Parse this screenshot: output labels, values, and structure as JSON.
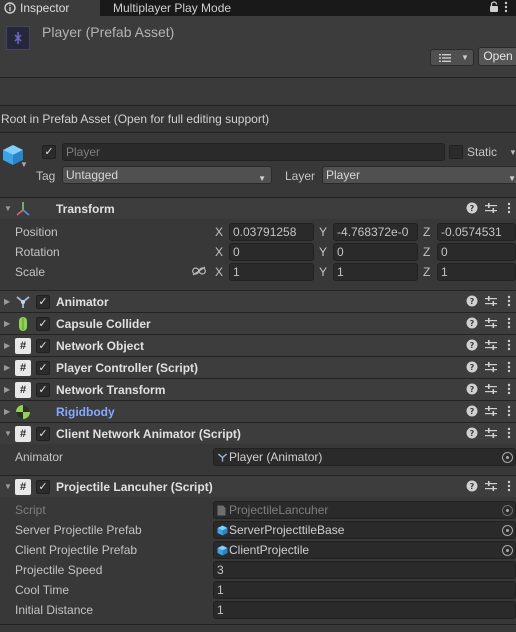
{
  "tabs": {
    "inspector": "Inspector",
    "multiplayer": "Multiplayer Play Mode"
  },
  "header": {
    "title": "Player (Prefab Asset)",
    "open_button": "Open"
  },
  "root_message": "Root in Prefab Asset (Open for full editing support)",
  "gameobject": {
    "active": true,
    "name": "Player",
    "static_label": "Static",
    "tag_label": "Tag",
    "tag_value": "Untagged",
    "layer_label": "Layer",
    "layer_value": "Player"
  },
  "transform": {
    "title": "Transform",
    "position_label": "Position",
    "rotation_label": "Rotation",
    "scale_label": "Scale",
    "axis_x": "X",
    "axis_y": "Y",
    "axis_z": "Z",
    "position": {
      "x": "0.03791258",
      "y": "-4.768372e-0",
      "z": "-0.0574531"
    },
    "rotation": {
      "x": "0",
      "y": "0",
      "z": "0"
    },
    "scale": {
      "x": "1",
      "y": "1",
      "z": "1"
    }
  },
  "components": {
    "animator": "Animator",
    "capsule_collider": "Capsule Collider",
    "network_object": "Network Object",
    "player_controller": "Player Controller (Script)",
    "network_transform": "Network Transform",
    "rigidbody": "Rigidbody",
    "client_network_animator": "Client Network Animator (Script)",
    "projectile": "Projectile Lancuher (Script)"
  },
  "client_network_animator": {
    "animator_label": "Animator",
    "animator_value": "Player (Animator)"
  },
  "projectile": {
    "script_label": "Script",
    "script_value": "ProjectileLancuher",
    "server_label": "Server Projectile Prefab",
    "server_value": "ServerProjecttileBase",
    "client_label": "Client Projectile Prefab",
    "client_value": "ClientProjectile",
    "speed_label": "Projectile Speed",
    "speed_value": "3",
    "cooltime_label": "Cool Time",
    "cooltime_value": "1",
    "distance_label": "Initial Distance",
    "distance_value": "1"
  },
  "icons": [
    "inspector-icon",
    "lock-icon",
    "menu-icon",
    "prefab-icon",
    "filter-icon",
    "gameobject-cube-icon",
    "transform-icon",
    "animator-icon",
    "capsule-collider-icon",
    "script-hash-icon",
    "rigidbody-icon",
    "help-icon",
    "preset-icon",
    "more-icon",
    "object-picker-icon",
    "link-icon"
  ],
  "colors": {
    "background": "#383838",
    "tabbar": "#191919",
    "rigidbody_label": "#84a9ff",
    "accent_blue": "#4aa0e0"
  }
}
